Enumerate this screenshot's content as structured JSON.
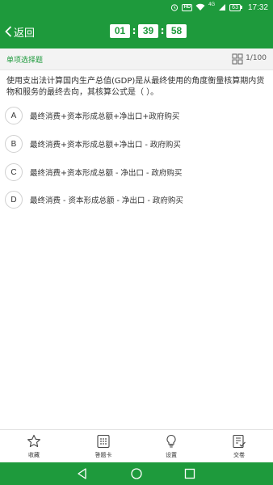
{
  "status_bar": {
    "hd_badge": "HD",
    "network": "4G",
    "battery": "63",
    "time": "17:32"
  },
  "top_bar": {
    "back_label": "返回",
    "timer": {
      "hours": "01",
      "minutes": "39",
      "seconds": "58",
      "separator": ":"
    }
  },
  "question_header": {
    "type_label": "单项选择题",
    "counter": "1/100"
  },
  "question": {
    "text": "使用支出法计算国内生产总值(GDP)是从最终使用的角度衡量核算期内货物和服务的最终去向，其核算公式是（        ）。",
    "options": [
      {
        "letter": "A",
        "text": "最终消费+资本形成总额+净出口+政府购买"
      },
      {
        "letter": "B",
        "text": "最终消费+资本形成总额+净出口 - 政府购买"
      },
      {
        "letter": "C",
        "text": "最终消费+资本形成总额 - 净出口 - 政府购买"
      },
      {
        "letter": "D",
        "text": "最终消费 - 资本形成总额 - 净出口 - 政府购买"
      }
    ]
  },
  "bottom_nav": {
    "items": [
      {
        "label": "收藏",
        "icon": "star-icon"
      },
      {
        "label": "答题卡",
        "icon": "answer-card-icon"
      },
      {
        "label": "设置",
        "icon": "lightbulb-icon"
      },
      {
        "label": "交卷",
        "icon": "submit-paper-icon"
      }
    ]
  },
  "system_nav": {
    "buttons": [
      "back-triangle-icon",
      "home-circle-icon",
      "recents-square-icon"
    ]
  },
  "colors": {
    "brand_green": "#1e9a3c",
    "type_bar_bg": "#f3f3f3"
  }
}
